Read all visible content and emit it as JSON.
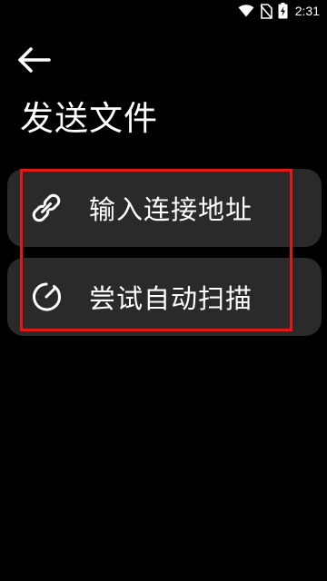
{
  "status_bar": {
    "time": "2:31",
    "icons": [
      "wifi-icon",
      "no-sim-icon",
      "battery-charging-icon"
    ]
  },
  "header": {
    "back_icon": "arrow-left-icon",
    "title": "发送文件"
  },
  "actions": [
    {
      "label": "输入连接地址",
      "icon": "link-icon"
    },
    {
      "label": "尝试自动扫描",
      "icon": "timer-scan-icon"
    }
  ],
  "colors": {
    "background": "#000000",
    "card": "#2a2a2a",
    "text": "#ffffff",
    "highlight": "#e01818"
  }
}
